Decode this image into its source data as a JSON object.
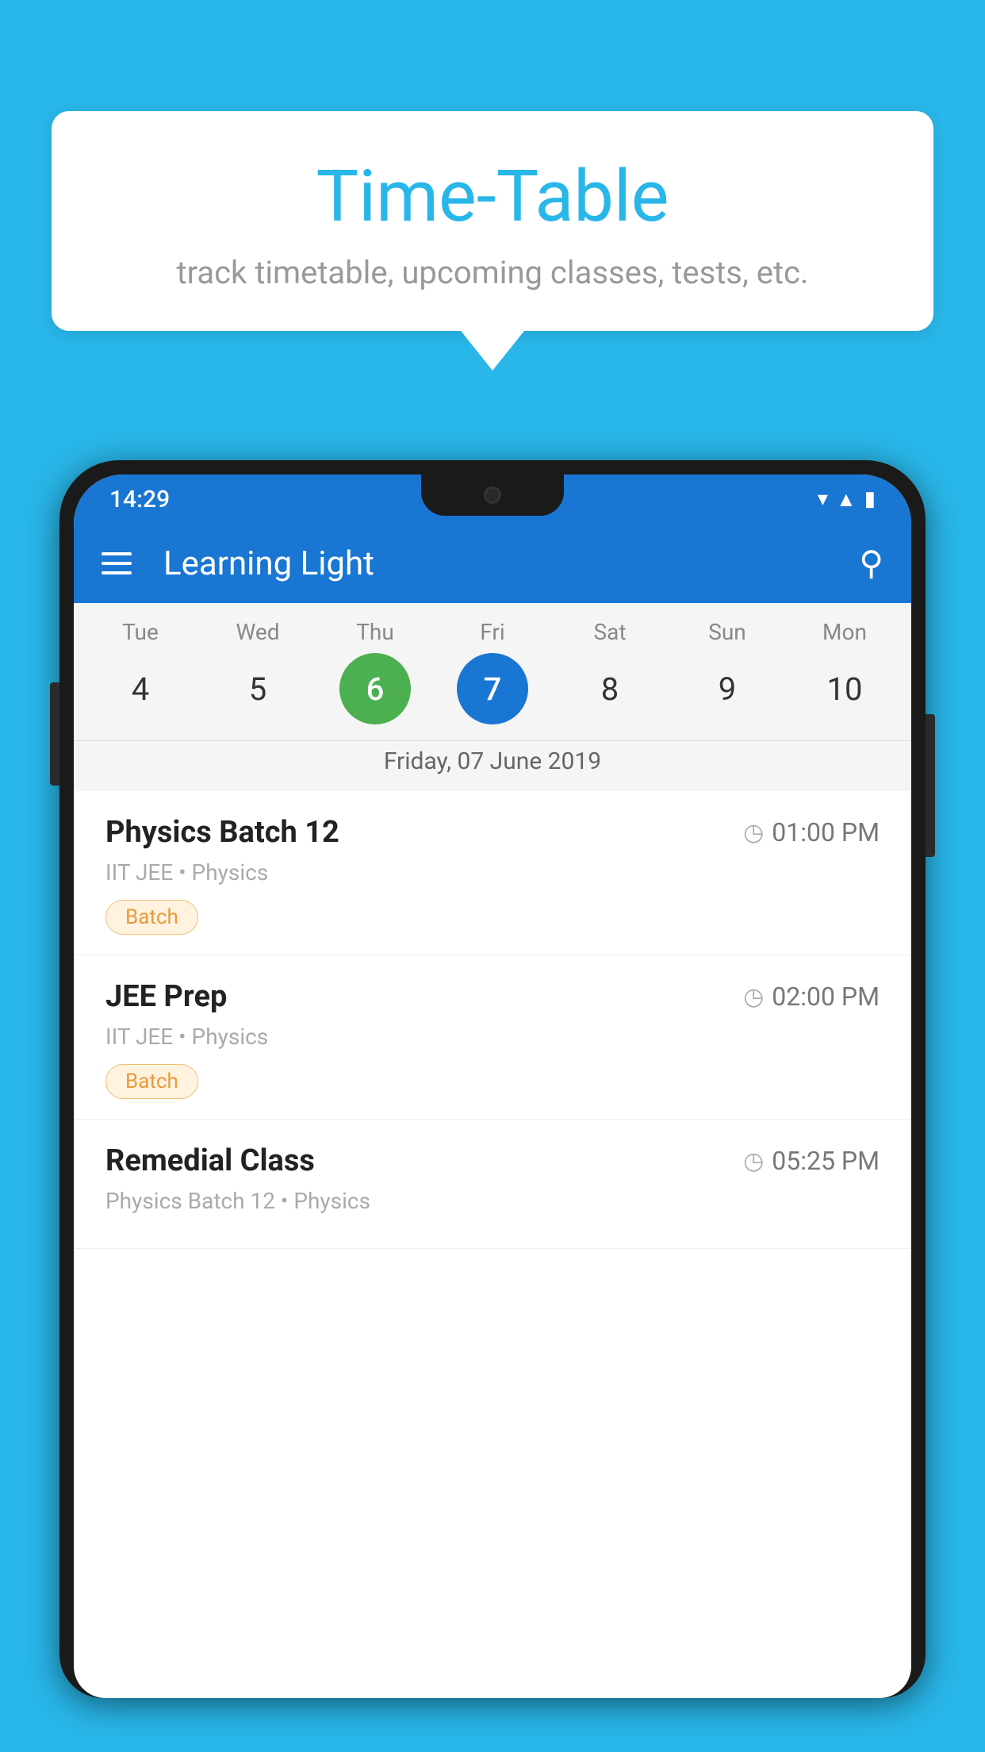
{
  "background_color": "#29b6e8",
  "speech_bubble": {
    "title": "Time-Table",
    "subtitle": "track timetable, upcoming classes, tests, etc."
  },
  "phone": {
    "status_bar": {
      "time": "14:29"
    },
    "app_bar": {
      "title": "Learning Light"
    },
    "calendar": {
      "days": [
        {
          "label": "Tue",
          "number": "4"
        },
        {
          "label": "Wed",
          "number": "5"
        },
        {
          "label": "Thu",
          "number": "6",
          "state": "today"
        },
        {
          "label": "Fri",
          "number": "7",
          "state": "selected"
        },
        {
          "label": "Sat",
          "number": "8"
        },
        {
          "label": "Sun",
          "number": "9"
        },
        {
          "label": "Mon",
          "number": "10"
        }
      ],
      "selected_date_label": "Friday, 07 June 2019"
    },
    "classes": [
      {
        "name": "Physics Batch 12",
        "time": "01:00 PM",
        "subtitle": "IIT JEE • Physics",
        "tag": "Batch"
      },
      {
        "name": "JEE Prep",
        "time": "02:00 PM",
        "subtitle": "IIT JEE • Physics",
        "tag": "Batch"
      },
      {
        "name": "Remedial Class",
        "time": "05:25 PM",
        "subtitle": "Physics Batch 12 • Physics",
        "tag": ""
      }
    ]
  }
}
